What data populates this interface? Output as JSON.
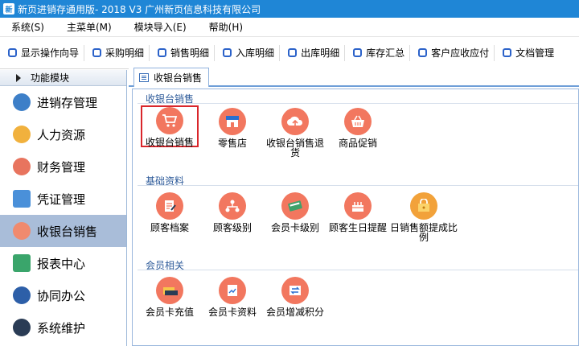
{
  "window": {
    "title": "新页进销存通用版- 2018 V3 广州新页信息科技有限公司"
  },
  "menubar": {
    "items": [
      "系统(S)",
      "主菜单(M)",
      "模块导入(E)",
      "帮助(H)"
    ]
  },
  "toolbar": {
    "items": [
      "显示操作向导",
      "采购明细",
      "销售明细",
      "入库明细",
      "出库明细",
      "库存汇总",
      "客户应收应付",
      "文档管理"
    ]
  },
  "sidebar": {
    "header": "功能模块",
    "items": [
      {
        "label": "进销存管理",
        "icon": "gear-icon"
      },
      {
        "label": "人力资源",
        "icon": "people-icon"
      },
      {
        "label": "财务管理",
        "icon": "yuan-icon"
      },
      {
        "label": "凭证管理",
        "icon": "voucher-icon"
      },
      {
        "label": "收银台销售",
        "icon": "cashier-icon"
      },
      {
        "label": "报表中心",
        "icon": "report-icon"
      },
      {
        "label": "协同办公",
        "icon": "collaboration-icon"
      },
      {
        "label": "系统维护",
        "icon": "maintenance-icon"
      }
    ],
    "active_index": 4
  },
  "tab": {
    "label": "收银台销售"
  },
  "groups": [
    {
      "title": "收银台销售",
      "items": [
        "收银台销售",
        "零售店",
        "收银台销售退货",
        "商品促销"
      ]
    },
    {
      "title": "基础资料",
      "items": [
        "顾客档案",
        "顾客级别",
        "会员卡级别",
        "顾客生日提醒",
        "日销售额提成比例"
      ]
    },
    {
      "title": "会员相关",
      "items": [
        "会员卡充值",
        "会员卡资料",
        "会员增减积分"
      ]
    }
  ],
  "colors": {
    "titlebar": "#1f86d6",
    "active_item": "#a9bdd9",
    "icon_circle": "#f2775f",
    "selection_border": "#d9262b",
    "group_title": "#2e5b9a"
  }
}
